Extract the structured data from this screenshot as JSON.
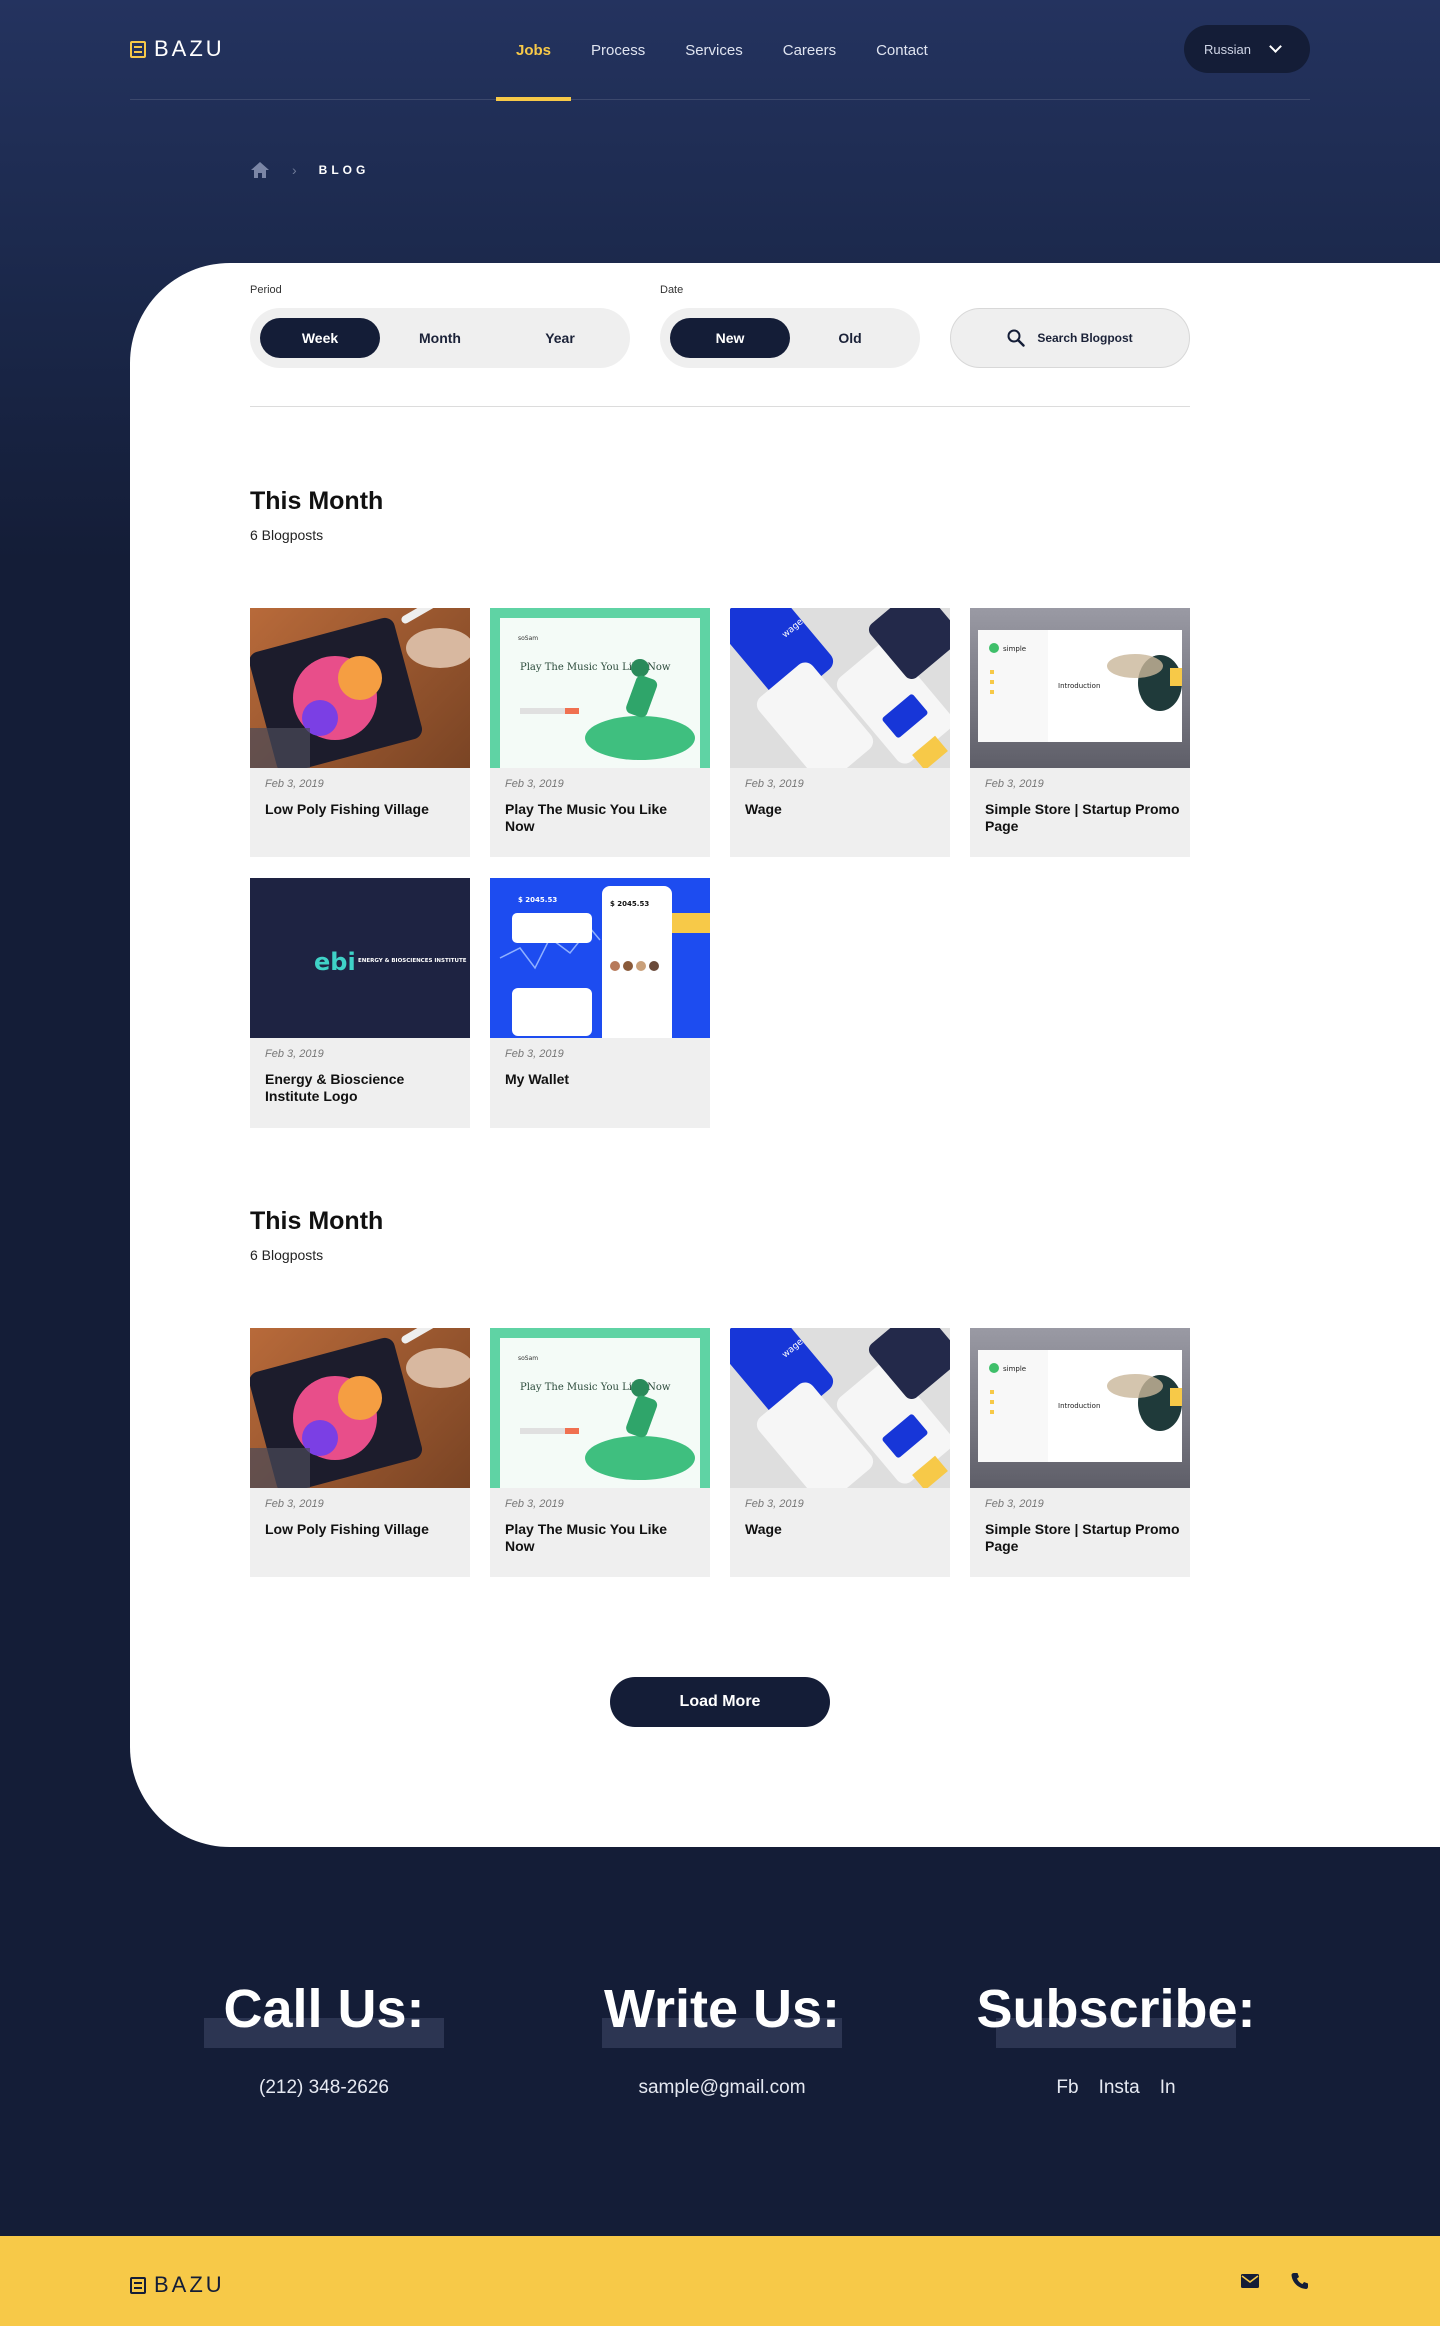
{
  "brand": {
    "name": "BAZU",
    "accent": "#f7c948",
    "navy": "#141d37"
  },
  "nav": {
    "items": [
      {
        "label": "Jobs",
        "active": true
      },
      {
        "label": "Process"
      },
      {
        "label": "Services"
      },
      {
        "label": "Careers"
      },
      {
        "label": "Contact"
      }
    ],
    "language": "Russian"
  },
  "breadcrumb": {
    "home_icon": "home-icon",
    "current": "BLOG"
  },
  "filters": {
    "period": {
      "label": "Period",
      "options": [
        "Week",
        "Month",
        "Year"
      ],
      "selected": "Week"
    },
    "date": {
      "label": "Date",
      "options": [
        "New",
        "Old"
      ],
      "selected": "New"
    },
    "search_label": "Search Blogpost"
  },
  "sections": [
    {
      "title": "This Month",
      "count": "6 Blogposts",
      "posts": [
        {
          "date": "Feb 3, 2019",
          "title": "Low Poly Fishing Village"
        },
        {
          "date": "Feb 3, 2019",
          "title": "Play The Music You Like Now"
        },
        {
          "date": "Feb 3, 2019",
          "title": "Wage"
        },
        {
          "date": "Feb 3, 2019",
          "title": "Simple Store | Startup Promo Page"
        },
        {
          "date": "Feb 3, 2019",
          "title": "Energy & Bioscience Institute Logo"
        },
        {
          "date": "Feb 3, 2019",
          "title": "My Wallet"
        }
      ]
    },
    {
      "title": "This Month",
      "count": "6 Blogposts",
      "posts": [
        {
          "date": "Feb 3, 2019",
          "title": "Low Poly Fishing Village"
        },
        {
          "date": "Feb 3, 2019",
          "title": "Play The Music You Like Now"
        },
        {
          "date": "Feb 3, 2019",
          "title": "Wage"
        },
        {
          "date": "Feb 3, 2019",
          "title": "Simple Store | Startup Promo Page"
        }
      ]
    }
  ],
  "thumb_text": {
    "music_brand": "soSam",
    "music_headline": "Play The Music You Like Now",
    "wage_brand": "wage",
    "store_brand": "simple",
    "store_heading": "Introduction",
    "ebi_letters": "ebi",
    "ebi_name": "ENERGY & BIOSCIENCES INSTITUTE",
    "wallet_amount": "$ 2045.53"
  },
  "load_more_label": "Load More",
  "footer": {
    "call": {
      "title": "Call Us:",
      "value": "(212) 348-2626"
    },
    "write": {
      "title": "Write Us:",
      "value": "sample@gmail.com"
    },
    "subscribe": {
      "title": "Subscribe:",
      "links": [
        "Fb",
        "Insta",
        "In"
      ]
    }
  },
  "bottom_bar": {
    "brand": "BAZU",
    "icons": [
      "mail-icon",
      "phone-icon"
    ]
  }
}
